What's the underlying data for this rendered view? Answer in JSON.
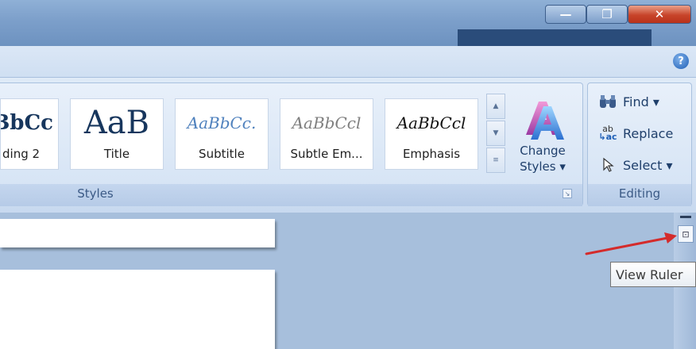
{
  "window": {
    "min_glyph": "—",
    "max_glyph": "❐",
    "close_glyph": "✕",
    "help_glyph": "?"
  },
  "ribbon": {
    "styles_group": {
      "label": "Styles",
      "items": [
        {
          "sample": "BbCc",
          "name": "ding 2"
        },
        {
          "sample": "AaB",
          "name": "Title"
        },
        {
          "sample": "AaBbCc.",
          "name": "Subtitle"
        },
        {
          "sample": "AaBbCcl",
          "name": "Subtle Em..."
        },
        {
          "sample": "AaBbCcl",
          "name": "Emphasis"
        }
      ],
      "change_styles": {
        "line1": "Change",
        "line2": "Styles ▾"
      }
    },
    "editing_group": {
      "label": "Editing",
      "find": "Find ▾",
      "replace": "Replace",
      "select": "Select ▾"
    }
  },
  "tooltip": {
    "text": "View Ruler"
  },
  "icons": [
    "minimize-icon",
    "maximize-icon",
    "close-icon",
    "help-icon",
    "binoculars-icon",
    "replace-icon",
    "cursor-icon",
    "view-ruler-icon",
    "change-styles-icon"
  ],
  "colors": {
    "accent": "#2a5c9a",
    "arrow": "#d42b2b",
    "close": "#c8442a"
  }
}
